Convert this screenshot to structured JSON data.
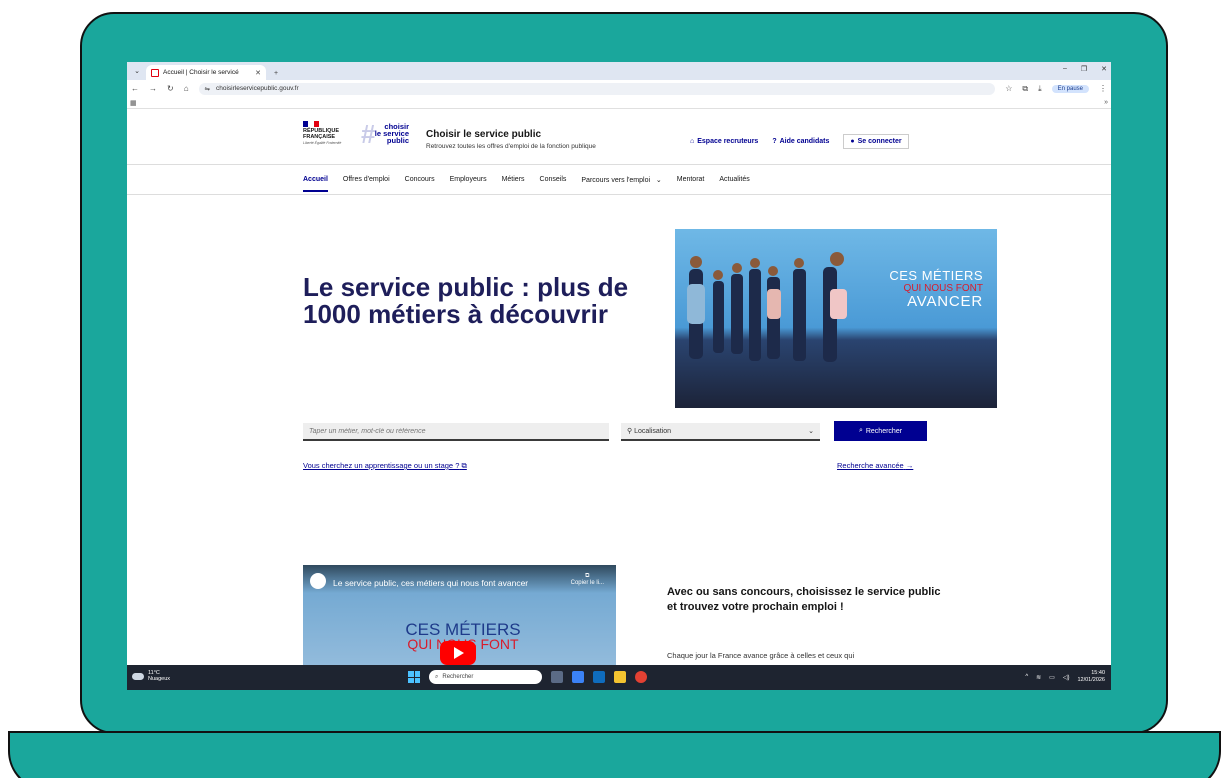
{
  "browser": {
    "tab_title": "Accueil | Choisir le servicé",
    "url": "choisirleservicepublic.gouv.fr",
    "pause_label": "En pause"
  },
  "header": {
    "republique": "RÉPUBLIQUE",
    "francaise": "FRANÇAISE",
    "devise": "Liberté Égalité Fraternité",
    "logo_line1": "choisir",
    "logo_line2": "le service",
    "logo_line3": "public",
    "site_title": "Choisir le service public",
    "tagline": "Retrouvez toutes les offres d'emploi de la fonction publique",
    "link_recruteurs": "Espace recruteurs",
    "link_aide": "Aide candidats",
    "link_login": "Se connecter"
  },
  "nav": {
    "items": [
      "Accueil",
      "Offres d'emploi",
      "Concours",
      "Employeurs",
      "Métiers",
      "Conseils",
      "Parcours vers l'emploi",
      "Mentorat",
      "Actualités"
    ]
  },
  "hero": {
    "title": "Le service public : plus de 1000 métiers à découvrir",
    "campaign_line1": "CES MÉTIERS",
    "campaign_line2": "QUI NOUS FONT",
    "campaign_line3": "AVANCER"
  },
  "search": {
    "placeholder": "Taper un métier, mot-clé ou référence",
    "location_label": "Localisation",
    "button_label": "Rechercher",
    "apprentissage_link": "Vous cherchez un apprentissage ou un stage ?",
    "advanced_link": "Recherche avancée"
  },
  "video": {
    "title": "Le service public, ces métiers qui nous font avancer",
    "copy_label": "Copier le li...",
    "text1": "CES MÉTIERS",
    "text2": "QUI NOUS FONT"
  },
  "section": {
    "heading": "Avec ou sans concours, choisissez le service public et trouvez votre prochain emploi !",
    "paragraph": "Chaque jour la France avance grâce à celles et ceux qui"
  },
  "taskbar": {
    "temperature": "11°C",
    "weather": "Nuageux",
    "search_label": "Rechercher",
    "time": "15:40",
    "date": "12/01/2026"
  },
  "colors": {
    "laptop": "#1aa79c",
    "accent": "#000091",
    "marianne_red": "#e1000f"
  }
}
